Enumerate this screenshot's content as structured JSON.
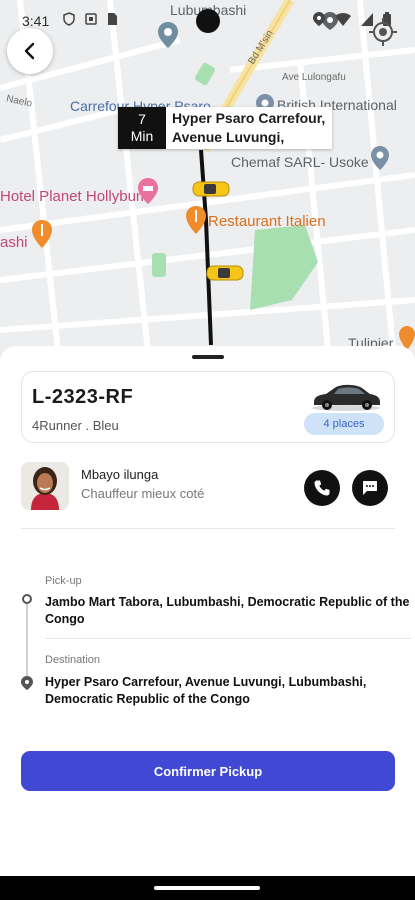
{
  "status_bar": {
    "time": "3:41"
  },
  "map": {
    "labels": {
      "lubumbashi": "Lubumbashi",
      "road_bd": "Bd M'sin",
      "ave_lulonga": "Ave Lulongafu",
      "ave_naelo": "Naelo",
      "carrefour": "Carrefour Hyper Psaro",
      "british": "British International",
      "chemaf": "Chemaf SARL- Usoke",
      "hotel": "Hotel Planet Hollybum",
      "restaurant": "Restaurant Italien",
      "ashi": "ashi",
      "tulipier": "Tulipier"
    },
    "eta": {
      "value": "7",
      "unit": "Min",
      "destination": "Hyper Psaro Carrefour, Avenue Luvungi,"
    }
  },
  "vehicle": {
    "plate": "L-2323-RF",
    "description": "4Runner . Bleu",
    "seats": "4 places"
  },
  "driver": {
    "name": "Mbayo ilunga",
    "role": "Chauffeur mieux coté"
  },
  "route": {
    "pickup_label": "Pick-up",
    "pickup_address": "Jambo Mart Tabora, Lubumbashi, Democratic Republic of the Congo",
    "destination_label": "Destination",
    "destination_address": "Hyper Psaro Carrefour, Avenue Luvungi, Lubumbashi, Democratic Republic of the Congo"
  },
  "actions": {
    "confirm": "Confirmer Pickup"
  },
  "colors": {
    "primary": "#4048d4",
    "badge_bg": "#cfe2f7",
    "badge_text": "#3566c7",
    "taxi": "#f5c518",
    "park": "#a8dfb0"
  },
  "icons": [
    "arrow-left-icon",
    "my-location-icon",
    "phone-icon",
    "chat-icon",
    "pin-icon",
    "car-icon",
    "taxi-icon",
    "restaurant-icon",
    "hotel-icon"
  ]
}
